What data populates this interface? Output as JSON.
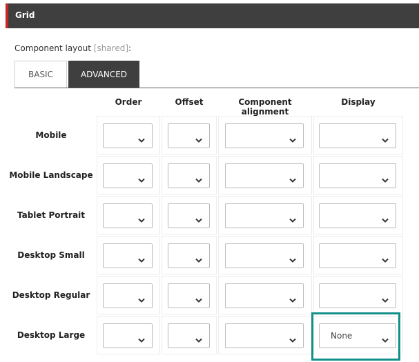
{
  "panel": {
    "title": "Grid"
  },
  "section": {
    "label": "Component layout",
    "shared_tag": "[shared]",
    "colon": ":"
  },
  "tabs": [
    {
      "label": "BASIC",
      "active": false
    },
    {
      "label": "ADVANCED",
      "active": true
    }
  ],
  "columns": [
    "Order",
    "Offset",
    "Component alignment",
    "Display"
  ],
  "rows": [
    {
      "label": "Mobile",
      "order": "",
      "offset": "",
      "alignment": "",
      "display": ""
    },
    {
      "label": "Mobile Landscape",
      "order": "",
      "offset": "",
      "alignment": "",
      "display": ""
    },
    {
      "label": "Tablet Portrait",
      "order": "",
      "offset": "",
      "alignment": "",
      "display": ""
    },
    {
      "label": "Desktop Small",
      "order": "",
      "offset": "",
      "alignment": "",
      "display": ""
    },
    {
      "label": "Desktop Regular",
      "order": "",
      "offset": "",
      "alignment": "",
      "display": ""
    },
    {
      "label": "Desktop Large",
      "order": "",
      "offset": "",
      "alignment": "",
      "display": "None"
    }
  ],
  "colors": {
    "header_bg": "#3f3f3f",
    "accent_red": "#c62828",
    "highlight": "#138f8b"
  }
}
